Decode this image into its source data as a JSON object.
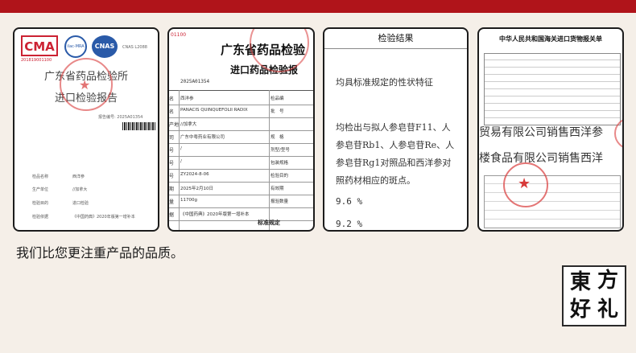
{
  "card1": {
    "badges": [
      "CMA",
      "ilac-MRA",
      "CNAS"
    ],
    "cnas_text": "CNAS L2088",
    "cma_number": "201819001100",
    "title_line1": "广东省药品检验所",
    "title_line2": "进口检验报告",
    "report_no": "报告编号: 2025A01354",
    "fields": [
      {
        "label": "检品名称",
        "value": "西洋参"
      },
      {
        "label": "生产单位",
        "value": "//加拿大"
      },
      {
        "label": "检验目的",
        "value": "进口检验"
      },
      {
        "label": "检验依据",
        "value": "《中国药典》2020年版第一增补本"
      }
    ]
  },
  "card2": {
    "corner_number": "01100",
    "title_line1": "广东省药品检验",
    "title_line2": "进口药品检验报",
    "report_no": "2025A01354",
    "rows": [
      {
        "left": "名",
        "value": "西洋参",
        "right": "检品编"
      },
      {
        "left": "名",
        "value": "PANACIS QUINQUEFOLII RADIX",
        "right": "批　号"
      },
      {
        "left": "产地",
        "value": "//加拿大",
        "right": ""
      },
      {
        "left": "司",
        "value": "广东中粤药业有限公司",
        "right": "规　格"
      },
      {
        "left": "号",
        "value": "/",
        "right": "剂型/型号"
      },
      {
        "left": "号",
        "value": "/",
        "right": "包装规格"
      },
      {
        "left": "号",
        "value": "ZY2024-8-06",
        "right": "检验目的"
      },
      {
        "left": "期",
        "value": "2025年2月10日",
        "right": "有效期"
      },
      {
        "left": "量",
        "value": "11700g",
        "right": "报验数量"
      },
      {
        "left": "据",
        "value": "《中国药典》2020年版第一增补本",
        "right": ""
      }
    ],
    "footer": "标准规定"
  },
  "card3": {
    "header": "检验结果",
    "line1": "均具标准规定的性状特征",
    "para": [
      "均检出与拟人参皂苷F11、人",
      "参皂苷Rb1、人参皂苷Re、人",
      "参皂苷Rg1对照品和西洋参对",
      "照药材相应的斑点。"
    ],
    "value1": "9.6 %",
    "value2": "9.2 %"
  },
  "card4": {
    "title": "中华人民共和国海关进口货物报关单",
    "overlay1": "贸易有限公司销售西洋参",
    "overlay2": "楼食品有限公司销售西洋"
  },
  "caption": "我们比您更注重产品的品质。",
  "logo_chars": [
    "東",
    "方",
    "好",
    "礼"
  ],
  "colors": {
    "topbar": "#b0141a",
    "stamp": "#d83a3a"
  }
}
